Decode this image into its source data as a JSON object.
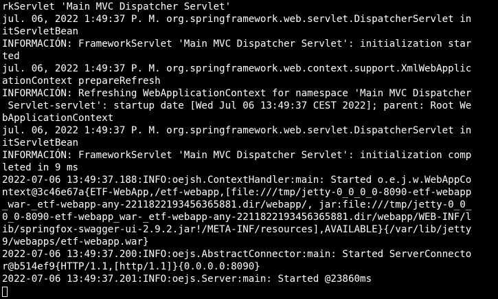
{
  "terminal": {
    "colors": {
      "background": "#000000",
      "foreground": "#ffffff"
    },
    "lines": [
      "rkServlet 'Main MVC Dispatcher Servlet'",
      "jul. 06, 2022 1:49:37 P. M. org.springframework.web.servlet.DispatcherServlet in",
      "itServletBean",
      "INFORMACIÓN: FrameworkServlet 'Main MVC Dispatcher Servlet': initialization star",
      "ted",
      "jul. 06, 2022 1:49:37 P. M. org.springframework.web.context.support.XmlWebApplic",
      "ationContext prepareRefresh",
      "INFORMACIÓN: Refreshing WebApplicationContext for namespace 'Main MVC Dispatcher",
      " Servlet-servlet': startup date [Wed Jul 06 13:49:37 CEST 2022]; parent: Root We",
      "bApplicationContext",
      "jul. 06, 2022 1:49:37 P. M. org.springframework.web.servlet.DispatcherServlet in",
      "itServletBean",
      "INFORMACIÓN: FrameworkServlet 'Main MVC Dispatcher Servlet': initialization comp",
      "leted in 9 ms",
      "2022-07-06 13:49:37.188:INFO:oejsh.ContextHandler:main: Started o.e.j.w.WebAppCo",
      "ntext@3c46e67a{ETF-WebApp,/etf-webapp,[file:///tmp/jetty-0_0_0_0-8090-etf-webapp",
      "_war-_etf-webapp-any-2211822193456365881.dir/webapp/, jar:file:///tmp/jetty-0_0_",
      "0_0-8090-etf-webapp_war-_etf-webapp-any-2211822193456365881.dir/webapp/WEB-INF/l",
      "ib/springfox-swagger-ui-2.9.2.jar!/META-INF/resources],AVAILABLE}{/var/lib/jetty",
      "9/webapps/etf-webapp.war}",
      "2022-07-06 13:49:37.200:INFO:oejs.AbstractConnector:main: Started ServerConnecto",
      "r@b514ef9{HTTP/1.1,[http/1.1]}{0.0.0.0:8090}",
      "2022-07-06 13:49:37.201:INFO:oejs.Server:main: Started @23860ms"
    ]
  }
}
